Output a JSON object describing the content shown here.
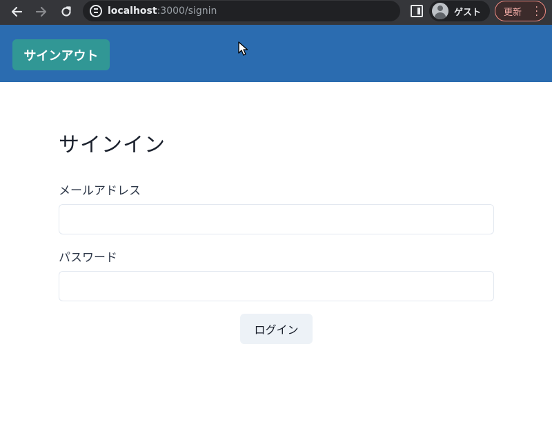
{
  "browser": {
    "url_host": "localhost",
    "url_path": ":3000/signin",
    "profile_label": "ゲスト",
    "update_label": "更新"
  },
  "header": {
    "signout_label": "サインアウト",
    "accent_color": "#2b6cb0",
    "button_color": "#319795"
  },
  "form": {
    "title": "サインイン",
    "email_label": "メールアドレス",
    "email_value": "",
    "password_label": "パスワード",
    "password_value": "",
    "submit_label": "ログイン"
  },
  "icons": {
    "back": "arrow-left-icon",
    "forward": "arrow-right-icon",
    "reload": "reload-icon",
    "site_info": "site-info-icon",
    "side_panel": "side-panel-icon",
    "profile": "profile-avatar-icon",
    "menu": "kebab-menu-icon",
    "cursor": "mouse-cursor-icon"
  }
}
